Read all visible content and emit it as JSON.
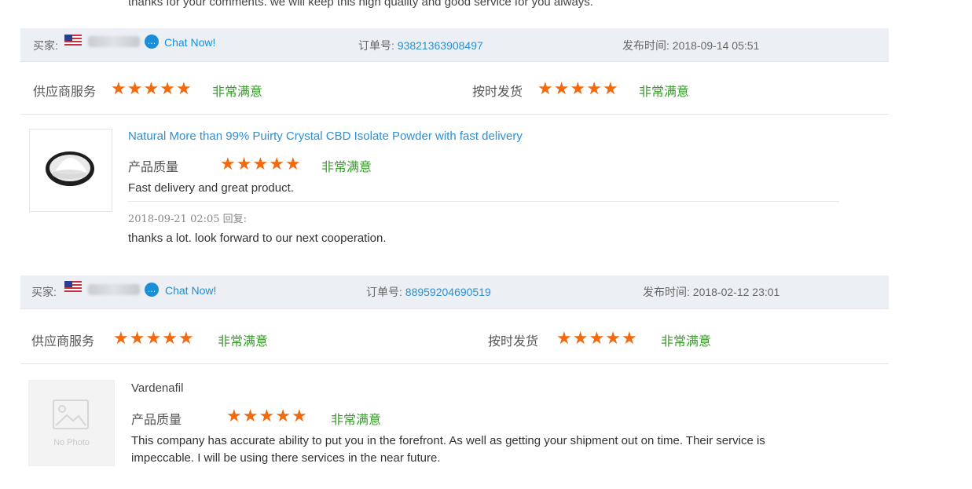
{
  "top_reply": "thanks for your comments. we will keep this high quality and good service for you always.",
  "reviews": [
    {
      "buyer_label": "买家:",
      "chat": "Chat Now!",
      "order_label": "订单号:",
      "order_number": "93821363908497",
      "date_label": "发布时间:",
      "date": "2018-09-14 05:51",
      "supplier_service_label": "供应商服务",
      "supplier_service_rating": 5,
      "supplier_service_text": "非常满意",
      "shipping_label": "按时发货",
      "shipping_rating": 5,
      "shipping_text": "非常满意",
      "product_title": "Natural More than 99% Puirty Crystal CBD Isolate Powder with fast delivery",
      "quality_label": "产品质量",
      "quality_rating": 5,
      "quality_text": "非常满意",
      "comment": "Fast delivery and great product.",
      "reply_meta": "2018-09-21 02:05  回复:",
      "reply": "thanks a lot. look forward to our next cooperation."
    },
    {
      "buyer_label": "买家:",
      "chat": "Chat Now!",
      "order_label": "订单号:",
      "order_number": "88959204690519",
      "date_label": "发布时间:",
      "date": "2018-02-12 23:01",
      "supplier_service_label": "供应商服务",
      "supplier_service_rating": 5,
      "supplier_service_text": "非常满意",
      "shipping_label": "按时发货",
      "shipping_rating": 5,
      "shipping_text": "非常满意",
      "product_title": "Vardenafil",
      "no_photo": "No Photo",
      "quality_label": "产品质量",
      "quality_rating": 5,
      "quality_text": "非常满意",
      "comment_line1": "This company has accurate ability to put you in the forefront. As well as getting your shipment out on time. Their service is",
      "comment_line2": "impeccable. I will be using there services in the near future."
    }
  ],
  "colors": {
    "star": "#f26a10",
    "positive": "#3a9c2c",
    "link": "#2e8fd1",
    "bar_bg": "#eceff3"
  },
  "icons": {
    "star": "star-icon",
    "chat": "chat-bubble-icon",
    "flag": "us-flag-icon",
    "no_photo": "image-placeholder-icon"
  }
}
